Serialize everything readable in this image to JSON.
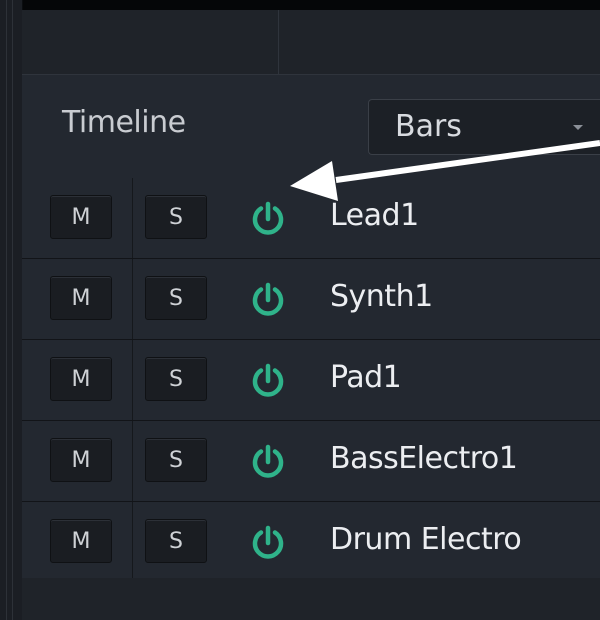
{
  "toolbar": {
    "timeline_label": "Timeline",
    "units_dropdown": {
      "selected": "Bars"
    }
  },
  "tracks": [
    {
      "mute_label": "M",
      "solo_label": "S",
      "name": "Lead1",
      "power_icon": "power-icon",
      "enabled": true
    },
    {
      "mute_label": "M",
      "solo_label": "S",
      "name": "Synth1",
      "power_icon": "power-icon",
      "enabled": true
    },
    {
      "mute_label": "M",
      "solo_label": "S",
      "name": "Pad1",
      "power_icon": "power-icon",
      "enabled": true
    },
    {
      "mute_label": "M",
      "solo_label": "S",
      "name": "BassElectro1",
      "power_icon": "power-icon",
      "enabled": true
    },
    {
      "mute_label": "M",
      "solo_label": "S",
      "name": "Drum Electro",
      "power_icon": "power-icon",
      "enabled": true
    }
  ],
  "colors": {
    "power_on": "#2fb38a",
    "background": "#1f2329",
    "annotation_arrow": "#ffffff"
  },
  "annotation": {
    "icon": "arrow-icon",
    "points_to": "power-icon"
  }
}
